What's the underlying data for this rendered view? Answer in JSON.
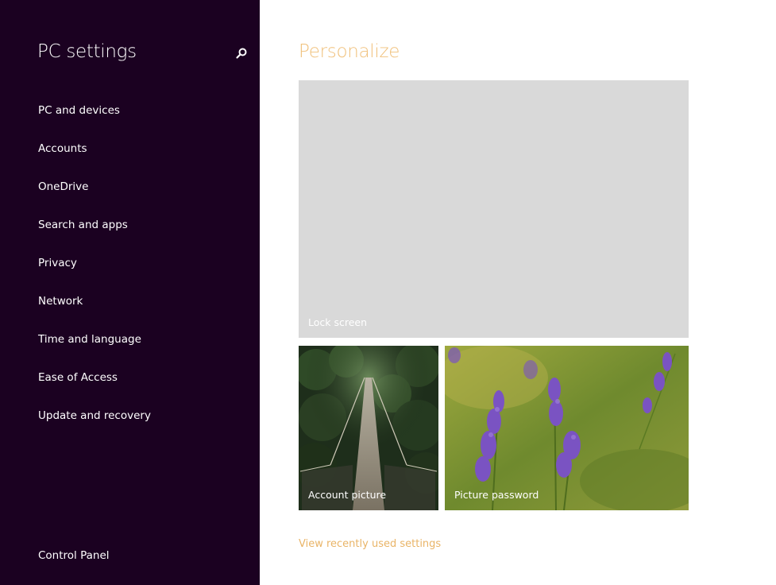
{
  "sidebar": {
    "title": "PC settings",
    "search_icon": "search-icon",
    "items": [
      {
        "label": "PC and devices"
      },
      {
        "label": "Accounts"
      },
      {
        "label": "OneDrive"
      },
      {
        "label": "Search and apps"
      },
      {
        "label": "Privacy"
      },
      {
        "label": "Network"
      },
      {
        "label": "Time and language"
      },
      {
        "label": "Ease of Access"
      },
      {
        "label": "Update and recovery"
      }
    ],
    "footer_link": "Control Panel"
  },
  "main": {
    "title": "Personalize",
    "tiles": [
      {
        "label": "Lock screen"
      },
      {
        "label": "Account picture"
      },
      {
        "label": "Picture password"
      }
    ],
    "recent_link": "View recently used settings"
  },
  "colors": {
    "sidebar_bg": "#1b0121",
    "accent": "#f0c07a",
    "lock_tile_bg": "#d9d9d9"
  }
}
